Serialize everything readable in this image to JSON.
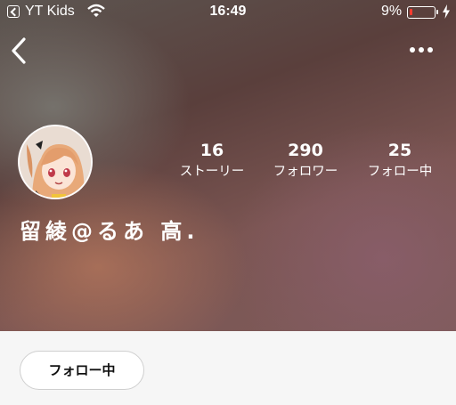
{
  "status_bar": {
    "app": "YT Kids",
    "time": "16:49",
    "battery": "9%"
  },
  "profile": {
    "name": "留綾@るあ 高.",
    "stats": [
      {
        "value": "16",
        "label": "ストーリー"
      },
      {
        "value": "290",
        "label": "フォロワー"
      },
      {
        "value": "25",
        "label": "フォロー中"
      }
    ],
    "follow_button": "フォロー中"
  },
  "colors": {
    "battery_low": "#ff3b30",
    "page_bg": "#f6f6f6"
  }
}
